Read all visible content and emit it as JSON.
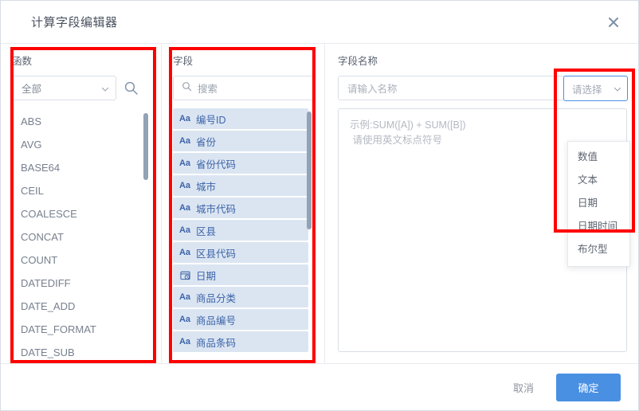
{
  "dialog": {
    "title": "计算字段编辑器",
    "close_icon": "close-icon"
  },
  "function_panel": {
    "label": "函数",
    "category_select": {
      "value": "全部",
      "chevron_icon": "chevron-down-icon"
    },
    "search_icon": "search-icon",
    "items": [
      "ABS",
      "AVG",
      "BASE64",
      "CEIL",
      "COALESCE",
      "CONCAT",
      "COUNT",
      "DATEDIFF",
      "DATE_ADD",
      "DATE_FORMAT",
      "DATE_SUB"
    ]
  },
  "field_panel": {
    "label": "字段",
    "search": {
      "placeholder": "搜索",
      "value": "",
      "icon": "search-icon"
    },
    "items": [
      {
        "name": "编号ID",
        "type_icon": "text-type-icon",
        "glyph": "Aa"
      },
      {
        "name": "省份",
        "type_icon": "text-type-icon",
        "glyph": "Aa"
      },
      {
        "name": "省份代码",
        "type_icon": "text-type-icon",
        "glyph": "Aa"
      },
      {
        "name": "城市",
        "type_icon": "text-type-icon",
        "glyph": "Aa"
      },
      {
        "name": "城市代码",
        "type_icon": "text-type-icon",
        "glyph": "Aa"
      },
      {
        "name": "区县",
        "type_icon": "text-type-icon",
        "glyph": "Aa"
      },
      {
        "name": "区县代码",
        "type_icon": "text-type-icon",
        "glyph": "Aa"
      },
      {
        "name": "日期",
        "type_icon": "date-type-icon",
        "glyph": ""
      },
      {
        "name": "商品分类",
        "type_icon": "text-type-icon",
        "glyph": "Aa"
      },
      {
        "name": "商品编号",
        "type_icon": "text-type-icon",
        "glyph": "Aa"
      },
      {
        "name": "商品条码",
        "type_icon": "text-type-icon",
        "glyph": "Aa"
      }
    ]
  },
  "expression_panel": {
    "label": "字段名称",
    "name_input": {
      "placeholder": "请输入名称",
      "value": ""
    },
    "type_select": {
      "value": "请选择",
      "chevron_icon": "chevron-down-icon",
      "expanded": true,
      "options": [
        "数值",
        "文本",
        "日期",
        "日期时间",
        "布尔型"
      ]
    },
    "formula": {
      "placeholder": "示例:SUM([A]) + SUM([B])\n 请使用英文标点符号",
      "value": ""
    }
  },
  "footer": {
    "cancel_label": "取消",
    "confirm_label": "确定"
  },
  "colors": {
    "accent": "#4a90e2",
    "field_item_bg": "#dbe5f2",
    "field_item_text": "#3c64a8",
    "annotation": "#fe0000",
    "border": "#d9dee5"
  }
}
